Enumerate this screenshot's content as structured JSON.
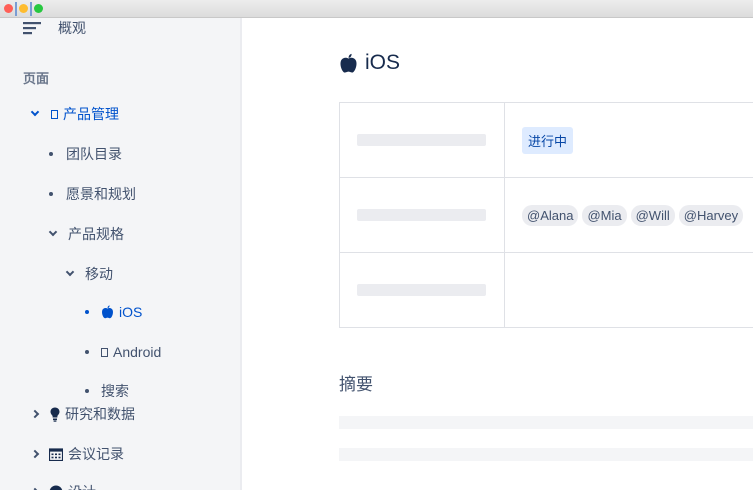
{
  "sidebar": {
    "overview_label": "概观",
    "section_label": "页面",
    "items": [
      {
        "label": "产品管理"
      },
      {
        "label": "团队目录"
      },
      {
        "label": "愿景和规划"
      },
      {
        "label": "产品规格"
      },
      {
        "label": "移动"
      },
      {
        "label": "iOS"
      },
      {
        "label": "Android"
      },
      {
        "label": "搜索"
      },
      {
        "label": "研究和数据"
      },
      {
        "label": "会议记录"
      },
      {
        "label": "设计"
      }
    ]
  },
  "page": {
    "title": "iOS",
    "status_label": "进行中",
    "mentions": [
      "@Alana",
      "@Mia",
      "@Will",
      "@Harvey"
    ],
    "summary_heading": "摘要"
  },
  "colors": {
    "accent": "#0052cc",
    "sidebar_bg": "#f4f5f7",
    "status_bg": "#deebff"
  }
}
